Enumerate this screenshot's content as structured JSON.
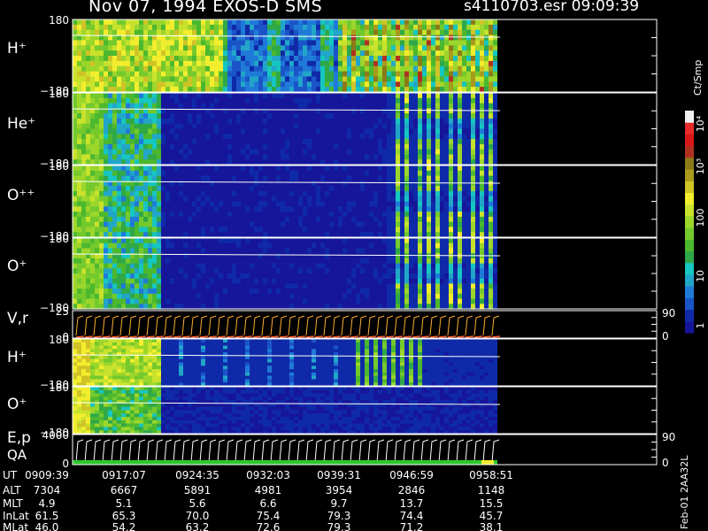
{
  "header": {
    "title": "Nov 07, 1994   EXOS-D SMS",
    "file_time": "s4110703.esr  09:09:39"
  },
  "footer_stamp": "Feb-01 2AA32L",
  "colorbar": {
    "unit": "Ct/Smp",
    "tick_labels": [
      "1",
      "10",
      "100",
      "10³",
      "10⁴"
    ],
    "colors": [
      "#16169a",
      "#0f2aa8",
      "#1a55c8",
      "#1f7ad8",
      "#22a6c8",
      "#16c6c0",
      "#2fa848",
      "#4cb82e",
      "#74c92d",
      "#9cd62b",
      "#c9e22c",
      "#f2ee2e",
      "#cfc326",
      "#a89a1c",
      "#8a7a18",
      "#b03020",
      "#d81818",
      "#e82a2a",
      "#f0f0f0"
    ]
  },
  "chart_data": {
    "type": "heatmap",
    "ut_ticks": [
      "0909:39",
      "0917:07",
      "0924:35",
      "0932:03",
      "0939:31",
      "0946:59",
      "0958:51"
    ],
    "ephemeris": [
      {
        "label": "UT",
        "values": [
          "0909:39",
          "0917:07",
          "0924:35",
          "0932:03",
          "0939:31",
          "0946:59",
          "0958:51"
        ]
      },
      {
        "label": "ALT",
        "values": [
          "7304",
          "6667",
          "5891",
          "4981",
          "3954",
          "2846",
          "1148"
        ]
      },
      {
        "label": "MLT",
        "values": [
          "4.9",
          "5.1",
          "5.6",
          "6.6",
          "9.7",
          "13.7",
          "15.5"
        ]
      },
      {
        "label": "InLat",
        "values": [
          "61.5",
          "65.3",
          "70.0",
          "75.4",
          "79.3",
          "74.4",
          "45.7"
        ]
      },
      {
        "label": "MLat",
        "values": [
          "46.0",
          "54.2",
          "63.2",
          "72.6",
          "79.3",
          "71.2",
          "38.1"
        ]
      }
    ],
    "panels": [
      {
        "label": "H⁺",
        "kind": "spectrogram",
        "ymax": "180",
        "ymin": "−180",
        "right_labels": []
      },
      {
        "label": "He⁺",
        "kind": "spectrogram",
        "ymax": "180",
        "ymin": "−180",
        "right_labels": []
      },
      {
        "label": "O⁺⁺",
        "kind": "spectrogram",
        "ymax": "180",
        "ymin": "−180",
        "right_labels": []
      },
      {
        "label": "O⁺",
        "kind": "spectrogram",
        "ymax": "180",
        "ymin": "−180",
        "right_labels": []
      },
      {
        "label": "V,r",
        "kind": "line",
        "ymax": "25",
        "ymin": "0",
        "right_labels": [
          "90",
          "0"
        ]
      },
      {
        "label": "H⁺",
        "kind": "spectrogram",
        "ymax": "180",
        "ymin": "−180",
        "right_labels": []
      },
      {
        "label": "O⁺",
        "kind": "spectrogram",
        "ymax": "180",
        "ymin": "−180",
        "right_labels": []
      },
      {
        "label": "E,p",
        "label2": "QA",
        "kind": "line",
        "ymax": "4000",
        "ymin": "0",
        "right_labels": [
          "90",
          "0"
        ]
      }
    ]
  }
}
